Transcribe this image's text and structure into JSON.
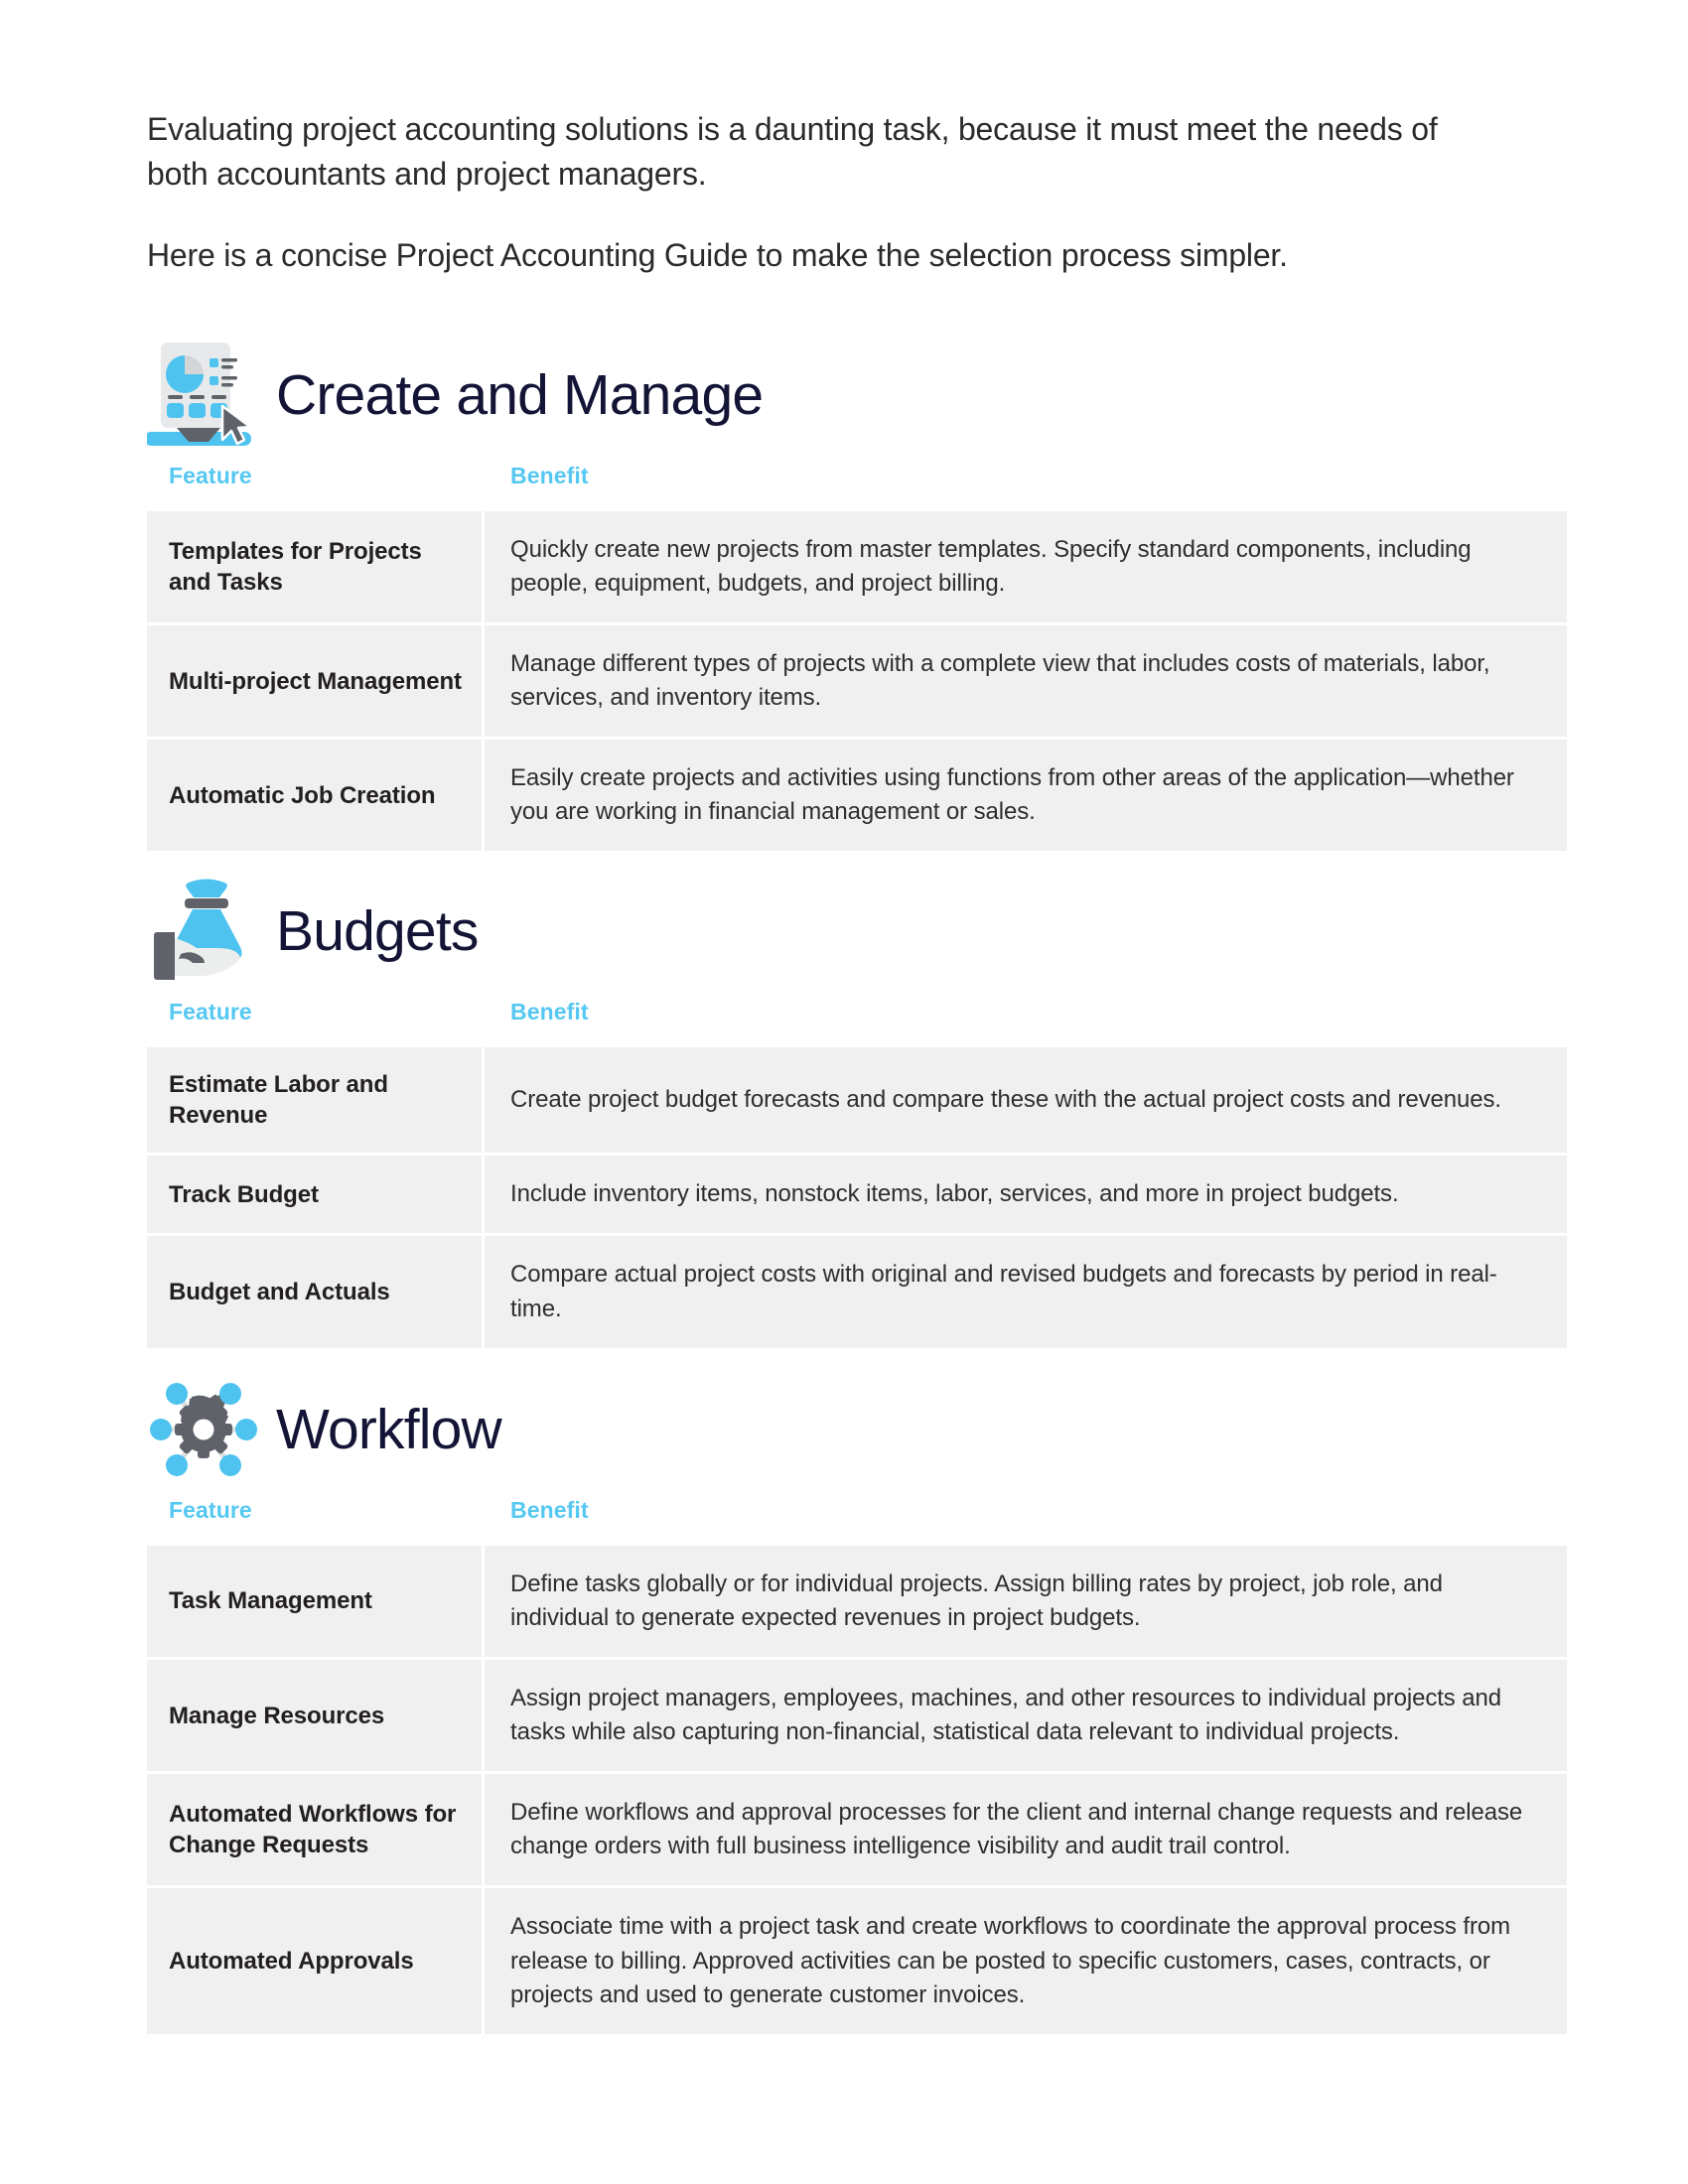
{
  "document": {
    "title": "Project Accounting Guide",
    "accent_color": "#55c8f2",
    "heading_color": "#141436",
    "row_background": "#f0f0f0",
    "page_background": "#ffffff"
  },
  "intro": {
    "paragraph1": "Evaluating project accounting solutions is a daunting task, because it must meet the needs of both accountants and project managers.",
    "paragraph2": "Here is a concise Project Accounting Guide to make the selection process simpler."
  },
  "columns": {
    "feature": "Feature",
    "benefit": "Benefit"
  },
  "sections": [
    {
      "id": "create-and-manage",
      "title": "Create and Manage",
      "icon": "dashboard-report-cursor-icon",
      "rows": [
        {
          "feature": "Templates for Projects and Tasks",
          "benefit": "Quickly create new projects from master templates. Specify standard components, including people, equipment, budgets, and project billing."
        },
        {
          "feature": "Multi-project Management",
          "benefit": "Manage different types of projects with a complete view that includes costs of materials, labor, services, and inventory items."
        },
        {
          "feature": "Automatic Job Creation",
          "benefit": "Easily create projects and activities using functions from other areas of the application—whether you are working in financial management or sales."
        }
      ]
    },
    {
      "id": "budgets",
      "title": "Budgets",
      "icon": "money-bag-in-hand-icon",
      "rows": [
        {
          "feature": "Estimate Labor and Revenue",
          "benefit": "Create project budget forecasts and compare these with the actual project costs and revenues."
        },
        {
          "feature": "Track Budget",
          "benefit": "Include inventory items, nonstock items, labor, services, and more in project budgets."
        },
        {
          "feature": "Budget and Actuals",
          "benefit": "Compare actual project costs with original and revised budgets and forecasts by period in real-time."
        }
      ]
    },
    {
      "id": "workflow",
      "title": "Workflow",
      "icon": "gear-network-nodes-icon",
      "rows": [
        {
          "feature": "Task Management",
          "benefit": "Define tasks globally or for individual projects. Assign billing rates by project, job role, and individual to generate expected revenues in project budgets."
        },
        {
          "feature": "Manage Resources",
          "benefit": "Assign project managers, employees, machines, and other resources to individual projects and tasks while also capturing non-financial, statistical data relevant to individual projects."
        },
        {
          "feature": "Automated Workflows for Change Requests",
          "benefit": "Define workflows and approval processes for the client and internal change requests and release change orders with full business intelligence visibility and audit trail control."
        },
        {
          "feature": "Automated Approvals",
          "benefit": "Associate time with a project task and create workflows to coordinate the approval process from release to billing. Approved activities can be posted to specific customers, cases, contracts, or projects and used to generate customer invoices."
        }
      ]
    }
  ]
}
